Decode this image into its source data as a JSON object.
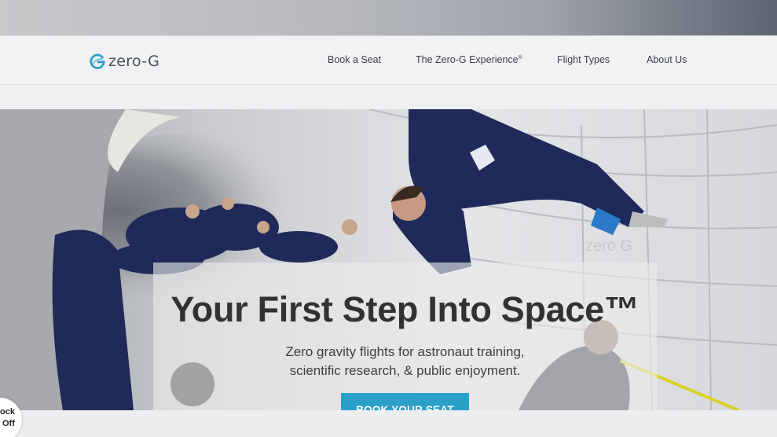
{
  "brand": {
    "name": "zero-G",
    "accent": "#2a9fc7"
  },
  "nav": {
    "items": [
      {
        "label": "Book a Seat"
      },
      {
        "label": "The Zero-G Experience",
        "mark": "®"
      },
      {
        "label": "Flight Types"
      },
      {
        "label": "About Us"
      }
    ]
  },
  "hero": {
    "headline": "Your First Step Into Space™",
    "subline_1": "Zero gravity flights for astronaut training,",
    "subline_2": "scientific research, & public enjoyment.",
    "cta_label": "BOOK YOUR SEAT",
    "cabin_mark": "zero G"
  },
  "badge": {
    "line1": "ock",
    "line2": "Off"
  },
  "colors": {
    "flight_suit": "#1f2a5a",
    "cabin": "#e3e4e6",
    "cta": "#2a9fc7"
  }
}
